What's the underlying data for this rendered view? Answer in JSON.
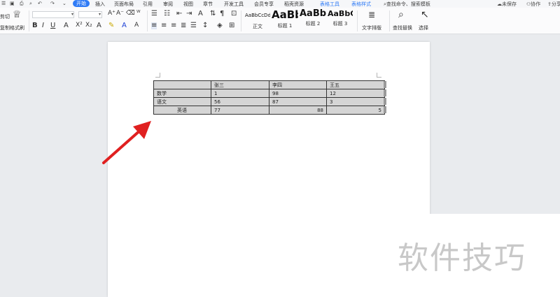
{
  "menubar": {
    "tabs": [
      "开始",
      "插入",
      "页面布局",
      "引用",
      "审阅",
      "视图",
      "章节",
      "开发工具",
      "会员专享",
      "稻壳资源",
      "表格工具",
      "表格样式"
    ],
    "search_placeholder": "查找命令、搜索模板",
    "unsaved_label": "未保存",
    "collab_label": "协作",
    "share_label": "分享"
  },
  "ribbon": {
    "cut_label": "剪切",
    "copy_label": "复制",
    "format_painter_label": "格式刷",
    "styles": [
      {
        "sample": "AaBbCcDd",
        "label": "正文"
      },
      {
        "sample": "AaBb",
        "label": "标题 1"
      },
      {
        "sample": "AaBb(",
        "label": "标题 2"
      },
      {
        "sample": "AaBbC",
        "label": "标题 3"
      }
    ],
    "text_layout_label": "文字排版",
    "find_replace_label": "查找替换",
    "select_label": "选择"
  },
  "table": {
    "header": [
      "",
      "张三",
      "李四",
      "王五"
    ],
    "rows": [
      [
        "数学",
        "1",
        "98",
        "12"
      ],
      [
        "语文",
        "56",
        "87",
        "3"
      ],
      [
        "英语",
        "77",
        "88",
        "5"
      ]
    ]
  },
  "watermark": "软件技巧"
}
